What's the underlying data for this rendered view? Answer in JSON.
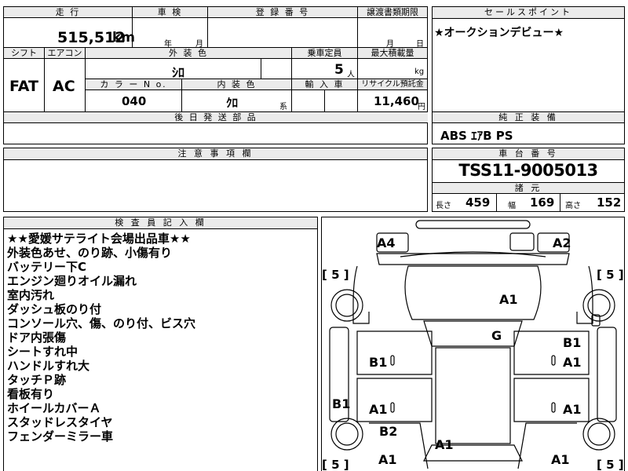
{
  "top_sheet": {
    "mileage_label": "走 行",
    "mileage_value": "515,512",
    "mileage_unit": "km",
    "inspection_label": "車 検",
    "inspection_year_unit": "年",
    "inspection_month_unit": "月",
    "registration_label": "登 録 番 号",
    "transfer_label": "譲渡書類期限",
    "transfer_month_unit": "月",
    "transfer_day_unit": "日",
    "shift_label": "シフト",
    "shift_value": "FAT",
    "ac_label": "エアコン",
    "ac_value": "AC",
    "exterior_label": "外 装 色",
    "exterior_value": "ｼﾛ",
    "capacity_label": "乗車定員",
    "capacity_value": "5",
    "capacity_unit": "人",
    "payload_label": "最大積載量",
    "payload_unit": "kg",
    "color_no_label": "カ ラ ー N o.",
    "color_no_value": "040",
    "interior_label": "内 装 色",
    "interior_value": "ｸﾛ",
    "interior_unit": "系",
    "import_label": "輸 入 車",
    "recycle_label": "リサイクル預託金",
    "recycle_value": "11,460",
    "recycle_unit": "円",
    "later_parts_label": "後 日 発 送 部 品"
  },
  "sales_point": {
    "label": "セールスポイント",
    "text": "★オークションデビュー★"
  },
  "equipment": {
    "label": "純 正 装 備",
    "value": "ABS ｴｱB PS"
  },
  "caution": {
    "label": "注 意 事 項 欄"
  },
  "chassis": {
    "label": "車 台 番 号",
    "value": "TSS11-9005013"
  },
  "specs": {
    "label": "諸 元",
    "length_label": "長さ",
    "length_value": "459",
    "width_label": "幅",
    "width_value": "169",
    "height_label": "高さ",
    "height_value": "152"
  },
  "inspector": {
    "label": "検 査 員 記 入 欄",
    "notes": [
      "★★愛媛サテライト会場出品車★★",
      "外装色あせ、のり跡、小傷有り",
      "バッテリー下C",
      "エンジン廻りオイル漏れ",
      "室内汚れ",
      "ダッシュ板のり付",
      "コンソール穴、傷、のり付、ビス穴",
      "ドア内張傷",
      "シートすれ中",
      "ハンドルすれ大",
      "タッチＰ跡",
      "看板有り",
      "ホイールカバーＡ",
      "スタッドレスタイヤ",
      "フェンダーミラー車"
    ]
  },
  "diagram": {
    "tread_marks": [
      "[ 5 ]",
      "[ 5 ]",
      "[ 5 ]",
      "[ 5 ]"
    ],
    "marks": {
      "front_left": "A4",
      "front_right": "A2",
      "hood": "A1",
      "roof": "G",
      "left_front_door": "B1",
      "right_front_door_top": "B1",
      "right_front_door": "A1",
      "left_sill": "B1",
      "left_rear_door": "A1",
      "right_rear_door": "A1",
      "left_rear_fender": "B2",
      "rear_left": "A1",
      "trunk": "A1",
      "rear_right": "A1"
    }
  }
}
